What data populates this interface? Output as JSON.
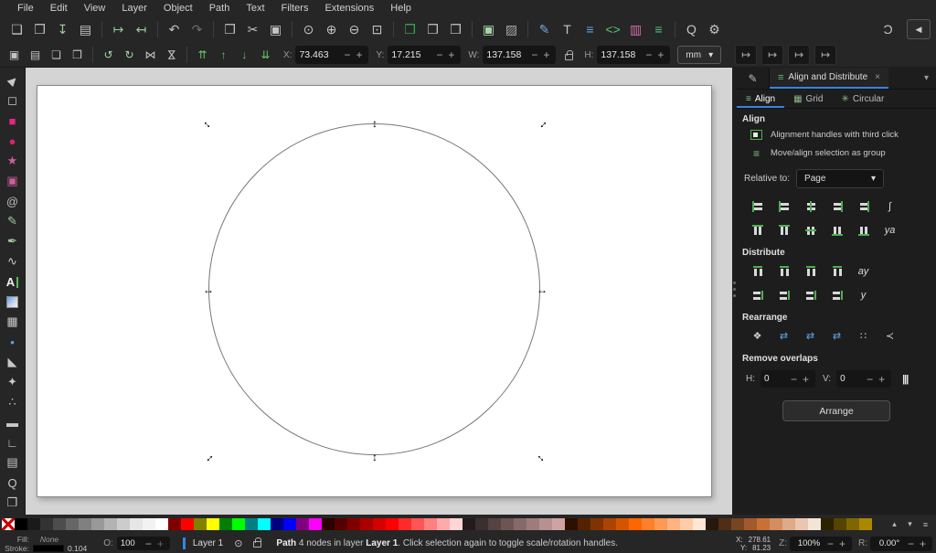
{
  "window": {
    "menus": [
      "File",
      "Edit",
      "View",
      "Layer",
      "Object",
      "Path",
      "Text",
      "Filters",
      "Extensions",
      "Help"
    ]
  },
  "ui": {
    "minus": "−",
    "plus": "+"
  },
  "cmdbar": {
    "g1": [
      {
        "n": "new-document-icon",
        "g": "❏"
      },
      {
        "n": "open-document-icon",
        "g": "❒"
      },
      {
        "n": "save-icon",
        "g": "↧",
        "c": "#9cc99c"
      },
      {
        "n": "print-icon",
        "g": "▤"
      }
    ],
    "g2": [
      {
        "n": "import-icon",
        "g": "↦",
        "c": "#9cc99c"
      },
      {
        "n": "export-icon",
        "g": "↤",
        "c": "#9cc99c"
      }
    ],
    "g3": [
      {
        "n": "undo-icon",
        "g": "↶"
      },
      {
        "n": "redo-icon",
        "g": "↷",
        "c": "#6e6e6e"
      }
    ],
    "g4": [
      {
        "n": "copy-icon",
        "g": "❐"
      },
      {
        "n": "cut-icon",
        "g": "✂"
      },
      {
        "n": "paste-icon",
        "g": "▣"
      }
    ],
    "g5": [
      {
        "n": "zoom-selection-icon",
        "g": "⊙"
      },
      {
        "n": "zoom-drawing-icon",
        "g": "⊕"
      },
      {
        "n": "zoom-page-icon",
        "g": "⊖"
      },
      {
        "n": "zoom-fit-icon",
        "g": "⊡"
      }
    ],
    "g6": [
      {
        "n": "duplicate-icon",
        "g": "❐",
        "c": "#3fae4a"
      },
      {
        "n": "create-clone-icon",
        "g": "❐"
      },
      {
        "n": "unlink-clone-icon",
        "g": "❒"
      }
    ],
    "g7": [
      {
        "n": "group-icon",
        "g": "▣",
        "c": "#a8d5a8"
      },
      {
        "n": "ungroup-icon",
        "g": "▨",
        "c": "#a8a8a8"
      }
    ],
    "g8": [
      {
        "n": "fill-stroke-dialog-icon",
        "g": "✎",
        "c": "#6ea8dc"
      },
      {
        "n": "text-dialog-icon",
        "g": "T"
      },
      {
        "n": "align-dialog-icon",
        "g": "≡",
        "c": "#58a6e8"
      },
      {
        "n": "xml-editor-icon",
        "g": "<>",
        "c": "#58c27a"
      },
      {
        "n": "document-properties-icon",
        "g": "▥",
        "c": "#d86ca8"
      },
      {
        "n": "layers-dialog-icon",
        "g": "≡",
        "c": "#58c27a"
      }
    ],
    "g9": [
      {
        "n": "find-replace-icon",
        "g": "Q"
      },
      {
        "n": "preferences-icon",
        "g": "⚙"
      }
    ],
    "snap": {
      "g": "Ɔ"
    },
    "collapse": {
      "g": "◀"
    }
  },
  "ctrlbar": {
    "sel": [
      {
        "n": "select-all-icon",
        "g": "▣"
      },
      {
        "n": "select-all-layers-icon",
        "g": "▤"
      },
      {
        "n": "deselect-icon",
        "g": "❏"
      },
      {
        "n": "selection-cue-icon",
        "g": "❒"
      }
    ],
    "transform": [
      {
        "n": "rotate-ccw-icon",
        "g": "↺",
        "c": "#a8d5a8"
      },
      {
        "n": "rotate-cw-icon",
        "g": "↻",
        "c": "#a8d5a8"
      },
      {
        "n": "flip-horizontal-icon",
        "g": "⋈"
      },
      {
        "n": "flip-vertical-icon",
        "g": "⋈",
        "cls": "rot90"
      }
    ],
    "zorder": [
      {
        "n": "raise-to-top-icon",
        "g": "⇈",
        "c": "#6abf6a"
      },
      {
        "n": "raise-icon",
        "g": "↑",
        "c": "#6abf6a"
      },
      {
        "n": "lower-icon",
        "g": "↓",
        "c": "#6abf6a"
      },
      {
        "n": "lower-to-bottom-icon",
        "g": "⇊",
        "c": "#6abf6a"
      }
    ],
    "fields": {
      "x": {
        "label": "X:",
        "value": "73.463"
      },
      "y": {
        "label": "Y:",
        "value": "17.215"
      },
      "w": {
        "label": "W:",
        "value": "137.158"
      },
      "h": {
        "label": "H:",
        "value": "137.158"
      }
    },
    "unit": {
      "value": "mm",
      "arrow": "▾"
    },
    "toggles": [
      {
        "n": "scale-stroke-toggle",
        "g": "↦"
      },
      {
        "n": "scale-corners-toggle",
        "g": "↦"
      },
      {
        "n": "move-gradients-toggle",
        "g": "↦"
      },
      {
        "n": "move-patterns-toggle",
        "g": "↦"
      }
    ]
  },
  "toolbox": [
    {
      "n": "selector-tool",
      "g": "▶",
      "cls": "selrot"
    },
    {
      "n": "node-tool",
      "g": "◻"
    },
    {
      "n": "rectangle-tool",
      "g": "■",
      "c": "#e5267e"
    },
    {
      "n": "ellipse-tool",
      "g": "●",
      "c": "#d6246e"
    },
    {
      "n": "star-tool",
      "g": "★",
      "c": "#c95f9b"
    },
    {
      "n": "box3d-tool",
      "g": "▣",
      "c": "#c95f9b"
    },
    {
      "n": "spiral-tool",
      "g": "@",
      "c": "#bbbbbb"
    },
    {
      "n": "pencil-tool",
      "g": "✎",
      "c": "#9cc99c"
    },
    {
      "n": "pen-tool",
      "g": "✒",
      "c": "#9cc99c"
    },
    {
      "n": "calligraphy-tool",
      "g": "∿"
    },
    {
      "n": "text-tool",
      "g": "A",
      "cls": "texttool"
    },
    {
      "n": "gradient-tool",
      "g": "",
      "cls": "grad"
    },
    {
      "n": "mesh-tool",
      "g": "▦"
    },
    {
      "n": "dropper-tool",
      "g": "•",
      "c": "#58a6e8"
    },
    {
      "n": "paint-bucket-tool",
      "g": "◣"
    },
    {
      "n": "tweak-tool",
      "g": "✦"
    },
    {
      "n": "spray-tool",
      "g": "∴"
    },
    {
      "n": "eraser-tool",
      "g": "▬"
    },
    {
      "n": "connector-tool",
      "g": "∟"
    },
    {
      "n": "measure-tool",
      "g": "▤"
    },
    {
      "n": "zoom-tool",
      "g": "Q"
    },
    {
      "n": "pages-tool",
      "g": "❐"
    }
  ],
  "canvas": {
    "h_arrow": "↔",
    "v_arrow": "↕"
  },
  "panel": {
    "header": {
      "dialog_tab_icon": "✎",
      "tab_icon": "≡",
      "title": "Align and Distribute",
      "close": "×",
      "menu": "▾"
    },
    "tabs": [
      {
        "n": "tab-align",
        "label": "Align",
        "g": "≡",
        "cls": "active"
      },
      {
        "n": "tab-grid",
        "label": "Grid",
        "g": "▦"
      },
      {
        "n": "tab-circular",
        "label": "Circular",
        "g": "✳"
      }
    ],
    "align": {
      "title": "Align",
      "options": [
        {
          "n": "alignment-handles-toggle",
          "label": "Alignment handles with third click",
          "g": "",
          "cls": "sq"
        },
        {
          "n": "move-as-group-toggle",
          "label": "Move/align selection as group",
          "g": "≡",
          "cls": "grp"
        }
      ],
      "relative_label": "Relative to:",
      "relative_value": "Page",
      "dropdown_arrow": "▾",
      "row1": [
        {
          "n": "align-right-to-anchor-left-button",
          "cls": "hb l"
        },
        {
          "n": "align-left-edges-button",
          "cls": "hb l2"
        },
        {
          "n": "center-on-vertical-axis-button",
          "cls": "hb c"
        },
        {
          "n": "align-right-edges-button",
          "cls": "hb r2"
        },
        {
          "n": "align-left-to-anchor-right-button",
          "cls": "hb r"
        },
        {
          "n": "text-anchor-horizontal-button",
          "g": "∫",
          "cls": "gtxt"
        }
      ],
      "row2": [
        {
          "n": "align-bottom-to-anchor-top-button",
          "cls": "hb vb l"
        },
        {
          "n": "align-top-edges-button",
          "cls": "hb vb l2"
        },
        {
          "n": "center-on-horizontal-axis-button",
          "cls": "hb vb c"
        },
        {
          "n": "align-bottom-edges-button",
          "cls": "hb vb r2"
        },
        {
          "n": "align-top-to-anchor-bottom-button",
          "cls": "hb vb r"
        },
        {
          "n": "text-baseline-button",
          "g": "ya",
          "cls": "gtxt"
        }
      ]
    },
    "distribute": {
      "title": "Distribute",
      "row1": [
        {
          "n": "distribute-left-edges-button",
          "cls": "db"
        },
        {
          "n": "distribute-centers-horizontally-button",
          "cls": "db"
        },
        {
          "n": "distribute-right-edges-button",
          "cls": "db"
        },
        {
          "n": "distribute-equal-horizontal-gaps-button",
          "cls": "db"
        },
        {
          "n": "distribute-text-anchors-button",
          "g": "ay",
          "cls": "gtxt"
        }
      ],
      "row2": [
        {
          "n": "distribute-top-edges-button",
          "cls": "db db2"
        },
        {
          "n": "distribute-centers-vertically-button",
          "cls": "db db2"
        },
        {
          "n": "distribute-bottom-edges-button",
          "cls": "db db2"
        },
        {
          "n": "distribute-equal-vertical-gaps-button",
          "cls": "db db2"
        },
        {
          "n": "distribute-text-baselines-button",
          "g": "y",
          "cls": "gtxt"
        }
      ]
    },
    "rearrange": {
      "title": "Rearrange",
      "row": [
        {
          "n": "graph-layout-button",
          "g": "❖",
          "cls": "gly"
        },
        {
          "n": "exchange-selection-order-button",
          "g": "⇄",
          "c": "#58a6e8",
          "cls": "gly"
        },
        {
          "n": "exchange-stacking-order-button",
          "g": "⇄",
          "c": "#58a6e8",
          "cls": "gly"
        },
        {
          "n": "exchange-clockwise-button",
          "g": "⇄",
          "c": "#58a6e8",
          "cls": "gly"
        },
        {
          "n": "randomize-positions-button",
          "g": "∷",
          "cls": "gly"
        },
        {
          "n": "unclump-button",
          "g": "≺",
          "cls": "gly"
        }
      ]
    },
    "remove_overlaps": {
      "title": "Remove overlaps",
      "h_label": "H:",
      "h_value": "0",
      "v_label": "V:",
      "v_value": "0",
      "icon": "|||"
    },
    "arrange_label": "Arrange"
  },
  "palette": {
    "swatches": [
      {
        "n": "palette-none-swatch",
        "cls": "none"
      },
      {
        "bg": "#000000"
      },
      {
        "bg": "#1a1a1a"
      },
      {
        "bg": "#333333"
      },
      {
        "bg": "#4d4d4d"
      },
      {
        "bg": "#666666"
      },
      {
        "bg": "#808080"
      },
      {
        "bg": "#999999"
      },
      {
        "bg": "#b3b3b3"
      },
      {
        "bg": "#cccccc"
      },
      {
        "bg": "#e6e6e6"
      },
      {
        "bg": "#f2f2f2"
      },
      {
        "bg": "#ffffff"
      },
      {
        "bg": "#800000"
      },
      {
        "bg": "#ff0000"
      },
      {
        "bg": "#808000"
      },
      {
        "bg": "#ffff00"
      },
      {
        "bg": "#008000"
      },
      {
        "bg": "#00ff00"
      },
      {
        "bg": "#008080"
      },
      {
        "bg": "#00ffff"
      },
      {
        "bg": "#000080"
      },
      {
        "bg": "#0000ff"
      },
      {
        "bg": "#800080"
      },
      {
        "bg": "#ff00ff"
      },
      {
        "bg": "#2b0000"
      },
      {
        "bg": "#550000"
      },
      {
        "bg": "#800000"
      },
      {
        "bg": "#aa0000"
      },
      {
        "bg": "#d40000"
      },
      {
        "bg": "#ff0000"
      },
      {
        "bg": "#ff2a2a"
      },
      {
        "bg": "#ff5555"
      },
      {
        "bg": "#ff8080"
      },
      {
        "bg": "#ffaaaa"
      },
      {
        "bg": "#ffd5d5"
      },
      {
        "bg": "#241c1c"
      },
      {
        "bg": "#3c2f2f"
      },
      {
        "bg": "#554242"
      },
      {
        "bg": "#6d5555"
      },
      {
        "bg": "#866969"
      },
      {
        "bg": "#9e7c7c"
      },
      {
        "bg": "#b79090"
      },
      {
        "bg": "#cfa3a3"
      },
      {
        "bg": "#2b1100"
      },
      {
        "bg": "#552200"
      },
      {
        "bg": "#803300"
      },
      {
        "bg": "#aa4400"
      },
      {
        "bg": "#d45500"
      },
      {
        "bg": "#ff6600"
      },
      {
        "bg": "#ff7f2a"
      },
      {
        "bg": "#ff9955"
      },
      {
        "bg": "#ffb380"
      },
      {
        "bg": "#ffccaa"
      },
      {
        "bg": "#ffe6d5"
      },
      {
        "bg": "#28170b"
      },
      {
        "bg": "#502d16"
      },
      {
        "bg": "#784421"
      },
      {
        "bg": "#a05a2c"
      },
      {
        "bg": "#c87137"
      },
      {
        "bg": "#d38d5f"
      },
      {
        "bg": "#deaa87"
      },
      {
        "bg": "#e9c6af"
      },
      {
        "bg": "#f4e3d7"
      },
      {
        "bg": "#2b2200"
      },
      {
        "bg": "#554400"
      },
      {
        "bg": "#806600"
      },
      {
        "bg": "#aa8800"
      }
    ],
    "controls": [
      {
        "n": "palette-scroll-up",
        "g": "▴"
      },
      {
        "n": "palette-scroll-down",
        "g": "▾"
      },
      {
        "n": "palette-menu-icon",
        "g": "≡"
      }
    ]
  },
  "statusbar": {
    "fill_label": "Fill:",
    "fill_value": "None",
    "stroke_label": "Stroke:",
    "stroke_width": "0.104",
    "opacity_label": "O:",
    "opacity_value": "100",
    "layer_name": "Layer 1",
    "eye": "⊙",
    "status_b1": "Path",
    "status_t1": " 4 nodes in layer ",
    "status_b2": "Layer 1",
    "status_t2": ". Click selection again to toggle scale/rotation handles.",
    "x_label": "X:",
    "x_value": "278.61",
    "y_label": "Y:",
    "y_value": "81.23",
    "zoom_label": "Z:",
    "zoom_value": "100%",
    "rotation_label": "R:",
    "rotation_value": "0.00°"
  }
}
